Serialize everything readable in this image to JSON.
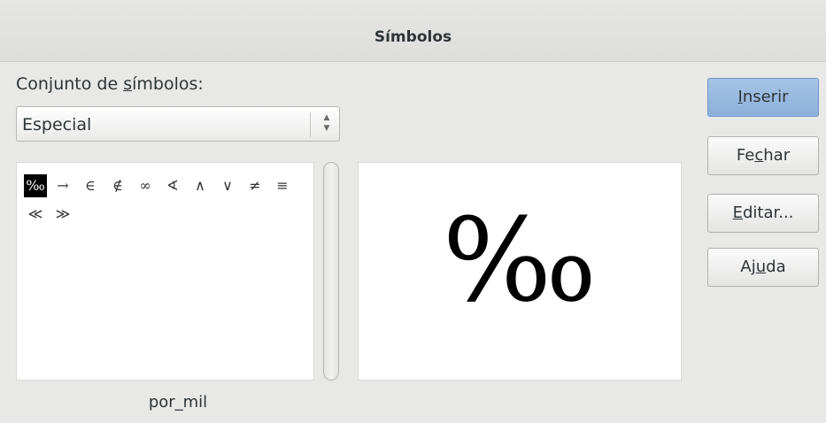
{
  "window": {
    "title": "Símbolos"
  },
  "symbol_set": {
    "label_pre": "Conjunto de ",
    "label_mnemonic": "s",
    "label_post": "ímbolos:",
    "selected": "Especial",
    "arrows": "▲▼"
  },
  "symbols": {
    "row1": [
      "‰",
      "→",
      "∈",
      "∉",
      "∞",
      "∢",
      "∧",
      "∨",
      "≠",
      "≡"
    ],
    "row2": [
      "≪",
      "≫"
    ],
    "selected_index": 0
  },
  "preview": {
    "glyph": "‰"
  },
  "symbol_name": "por_mil",
  "buttons": {
    "insert": {
      "mn": "I",
      "rest": "nserir"
    },
    "close": {
      "pre": "Fe",
      "mn": "c",
      "post": "har"
    },
    "edit": {
      "mn": "E",
      "rest": "ditar..."
    },
    "help": {
      "pre": "Aj",
      "mn": "u",
      "post": "da"
    }
  },
  "colors": {
    "primary_button": "#8cb1dc",
    "selection": "#000000"
  }
}
